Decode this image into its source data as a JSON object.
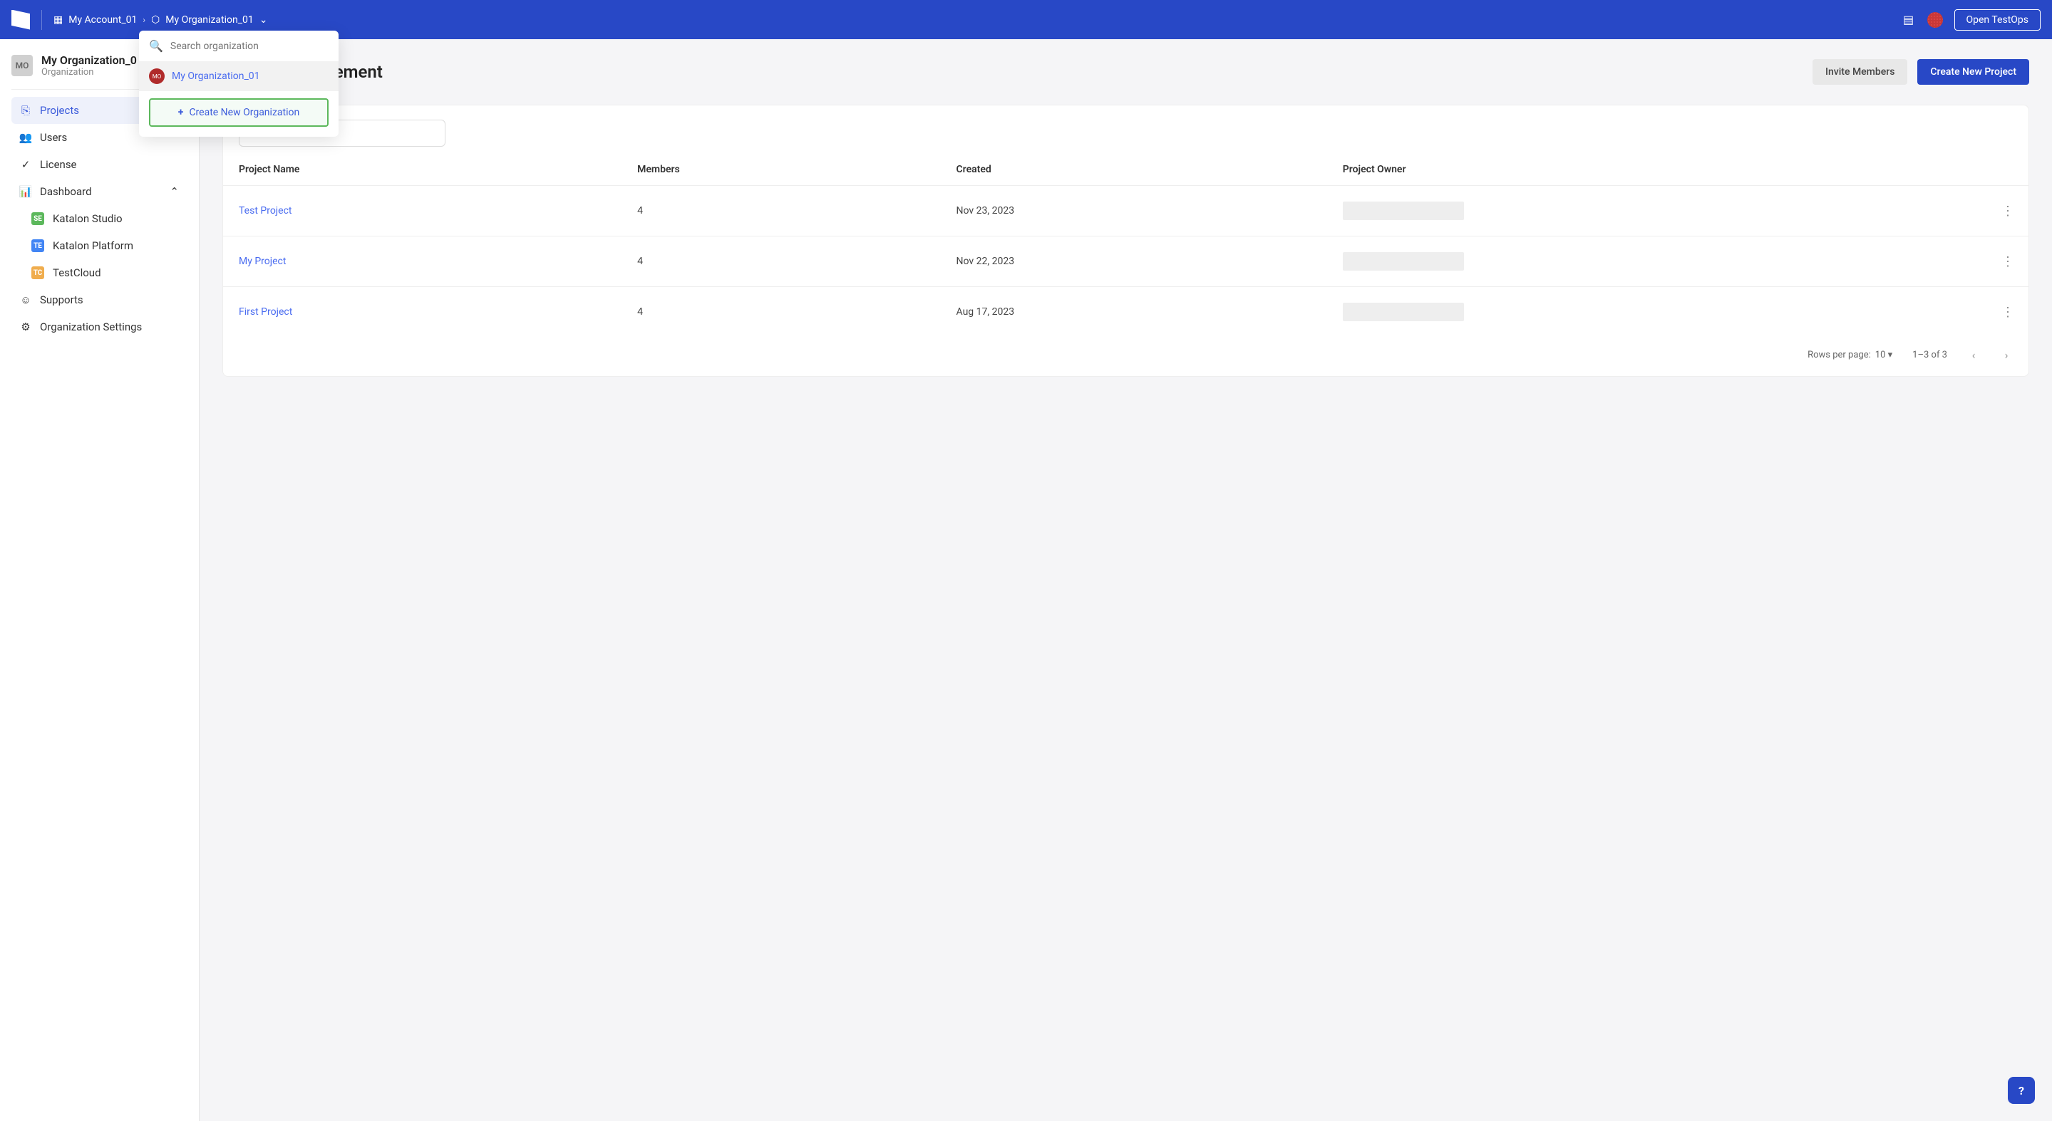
{
  "header": {
    "account": "My Account_01",
    "org": "My Organization_01",
    "open_testops": "Open TestOps"
  },
  "dropdown": {
    "search_placeholder": "Search organization",
    "org_avatar_text": "MO",
    "org_name": "My Organization_01",
    "create_label": "Create New Organization"
  },
  "sidebar": {
    "avatar": "MO",
    "org_name": "My Organization_0",
    "org_type": "Organization",
    "nav": {
      "projects": "Projects",
      "users": "Users",
      "license": "License",
      "dashboard": "Dashboard",
      "katalon_studio": "Katalon Studio",
      "katalon_platform": "Katalon Platform",
      "testcloud": "TestCloud",
      "supports": "Supports",
      "org_settings": "Organization Settings"
    }
  },
  "main": {
    "title_suffix": "ement",
    "invite": "Invite Members",
    "create_project": "Create New Project",
    "search_placeholder": "",
    "table": {
      "headers": {
        "name": "Project Name",
        "members": "Members",
        "created": "Created",
        "owner": "Project Owner"
      },
      "rows": [
        {
          "name": "Test Project",
          "members": "4",
          "created": "Nov 23, 2023"
        },
        {
          "name": "My Project",
          "members": "4",
          "created": "Nov 22, 2023"
        },
        {
          "name": "First Project",
          "members": "4",
          "created": "Aug 17, 2023"
        }
      ]
    },
    "pagination": {
      "rows_label": "Rows per page:",
      "rows_value": "10",
      "range": "1–3 of 3"
    }
  }
}
